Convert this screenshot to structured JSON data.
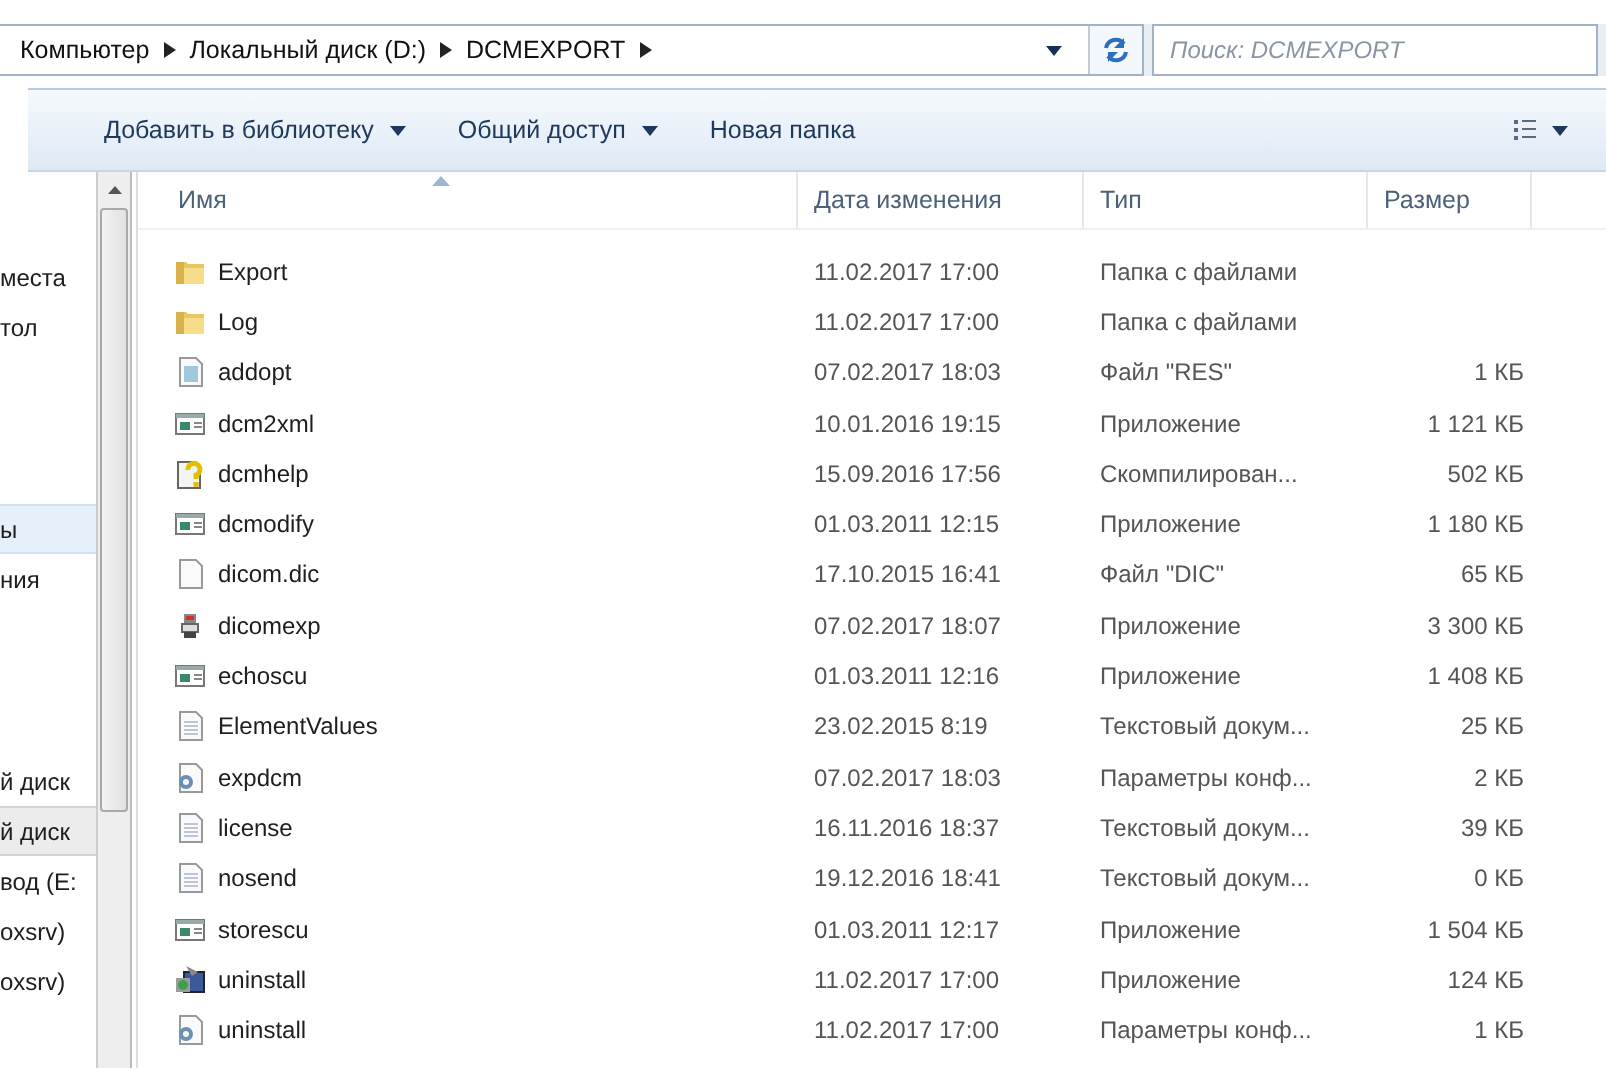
{
  "address_bar": {
    "crumbs": [
      "Компьютер",
      "Локальный диск (D:)",
      "DCMEXPORT"
    ]
  },
  "search": {
    "placeholder": "Поиск: DCMEXPORT"
  },
  "toolbar": {
    "buttons": [
      {
        "label": "Добавить в библиотеку",
        "dropdown": true
      },
      {
        "label": "Общий доступ",
        "dropdown": true
      },
      {
        "label": "Новая папка",
        "dropdown": false
      }
    ]
  },
  "sidebar": {
    "groups": [
      {
        "items": [
          {
            "label": "места",
            "selected": false,
            "hovered": false
          },
          {
            "label": "тол",
            "selected": false,
            "hovered": false
          }
        ]
      },
      {
        "items": [
          {
            "label": "ы",
            "selected": false,
            "hovered": true
          },
          {
            "label": "ния",
            "selected": false,
            "hovered": false
          }
        ]
      },
      {
        "items": [
          {
            "label": "й диск",
            "selected": false,
            "hovered": false
          },
          {
            "label": "й диск",
            "selected": true,
            "hovered": false
          },
          {
            "label": "вод (E:",
            "selected": false,
            "hovered": false
          },
          {
            "label": "oxsrv)",
            "selected": false,
            "hovered": false
          },
          {
            "label": "oxsrv)",
            "selected": false,
            "hovered": false
          }
        ]
      }
    ]
  },
  "table": {
    "columns": [
      "Имя",
      "Дата изменения",
      "Тип",
      "Размер"
    ],
    "rows": [
      {
        "kind": "folder",
        "name": "Export",
        "date": "11.02.2017 17:00",
        "type": "Папка с файлами"
      },
      {
        "kind": "folder",
        "name": "Log",
        "date": "11.02.2017 17:00",
        "type": "Папка с файлами"
      },
      {
        "kind": "file",
        "name": "addopt",
        "date": "07.02.2017 18:03",
        "type": "Файл \"RES\"",
        "size": "1 КБ"
      },
      {
        "kind": "app",
        "name": "dcm2xml",
        "date": "10.01.2016 19:15",
        "type": "Приложение",
        "size": "1 121 КБ"
      },
      {
        "kind": "help",
        "name": "dcmhelp",
        "date": "15.09.2016 17:56",
        "type": "Скомпилирован...",
        "size": "502 КБ"
      },
      {
        "kind": "app",
        "name": "dcmodify",
        "date": "01.03.2011 12:15",
        "type": "Приложение",
        "size": "1 180 КБ"
      },
      {
        "kind": "blank",
        "name": "dicom.dic",
        "date": "17.10.2015 16:41",
        "type": "Файл \"DIC\"",
        "size": "65 КБ"
      },
      {
        "kind": "program",
        "name": "dicomexp",
        "date": "07.02.2017 18:07",
        "type": "Приложение",
        "size": "3 300 КБ"
      },
      {
        "kind": "app",
        "name": "echoscu",
        "date": "01.03.2011 12:16",
        "type": "Приложение",
        "size": "1 408 КБ"
      },
      {
        "kind": "text",
        "name": "ElementValues",
        "date": "23.02.2015 8:19",
        "type": "Текстовый докум...",
        "size": "25 КБ"
      },
      {
        "kind": "config",
        "name": "expdcm",
        "date": "07.02.2017 18:03",
        "type": "Параметры конф...",
        "size": "2 КБ"
      },
      {
        "kind": "text",
        "name": "license",
        "date": "16.11.2016 18:37",
        "type": "Текстовый докум...",
        "size": "39 КБ"
      },
      {
        "kind": "text",
        "name": "nosend",
        "date": "19.12.2016 18:41",
        "type": "Текстовый докум...",
        "size": "0 КБ"
      },
      {
        "kind": "app",
        "name": "storescu",
        "date": "01.03.2011 12:17",
        "type": "Приложение",
        "size": "1 504 КБ"
      },
      {
        "kind": "setup",
        "name": "uninstall",
        "date": "11.02.2017 17:00",
        "type": "Приложение",
        "size": "124 КБ"
      },
      {
        "kind": "config",
        "name": "uninstall",
        "date": "11.02.2017 17:00",
        "type": "Параметры конф...",
        "size": "1 КБ"
      }
    ]
  }
}
